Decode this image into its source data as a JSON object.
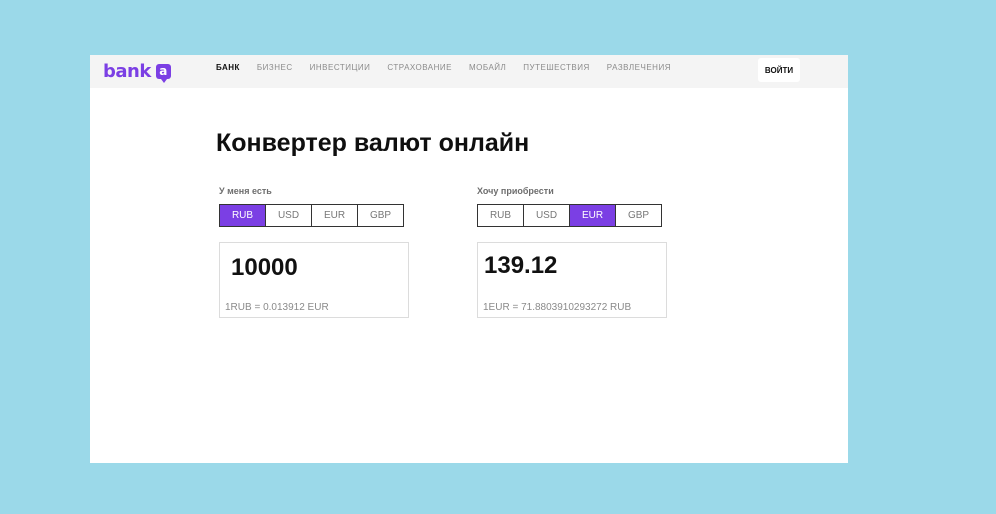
{
  "header": {
    "logo_text": "bank",
    "logo_badge": "a",
    "nav": [
      "БАНК",
      "БИЗНЕС",
      "ИНВЕСТИЦИИ",
      "СТРАХОВАНИЕ",
      "МОБАЙЛ",
      "ПУТЕШЕСТВИЯ",
      "РАЗВЛЕЧЕНИЯ"
    ],
    "login_label": "ВОЙТИ"
  },
  "main": {
    "title": "Конвертер валют онлайн",
    "from": {
      "label": "У меня есть",
      "currencies": [
        "RUB",
        "USD",
        "EUR",
        "GBP"
      ],
      "selected": "RUB",
      "amount": "10000",
      "rate": "1RUB = 0.013912 EUR"
    },
    "to": {
      "label": "Хочу приобрести",
      "currencies": [
        "RUB",
        "USD",
        "EUR",
        "GBP"
      ],
      "selected": "EUR",
      "amount": "139.12",
      "rate": "1EUR = 71.8803910293272 RUB"
    }
  },
  "colors": {
    "accent": "#7b3fe4",
    "background": "#9bd9e9",
    "header": "#f4f4f4"
  }
}
